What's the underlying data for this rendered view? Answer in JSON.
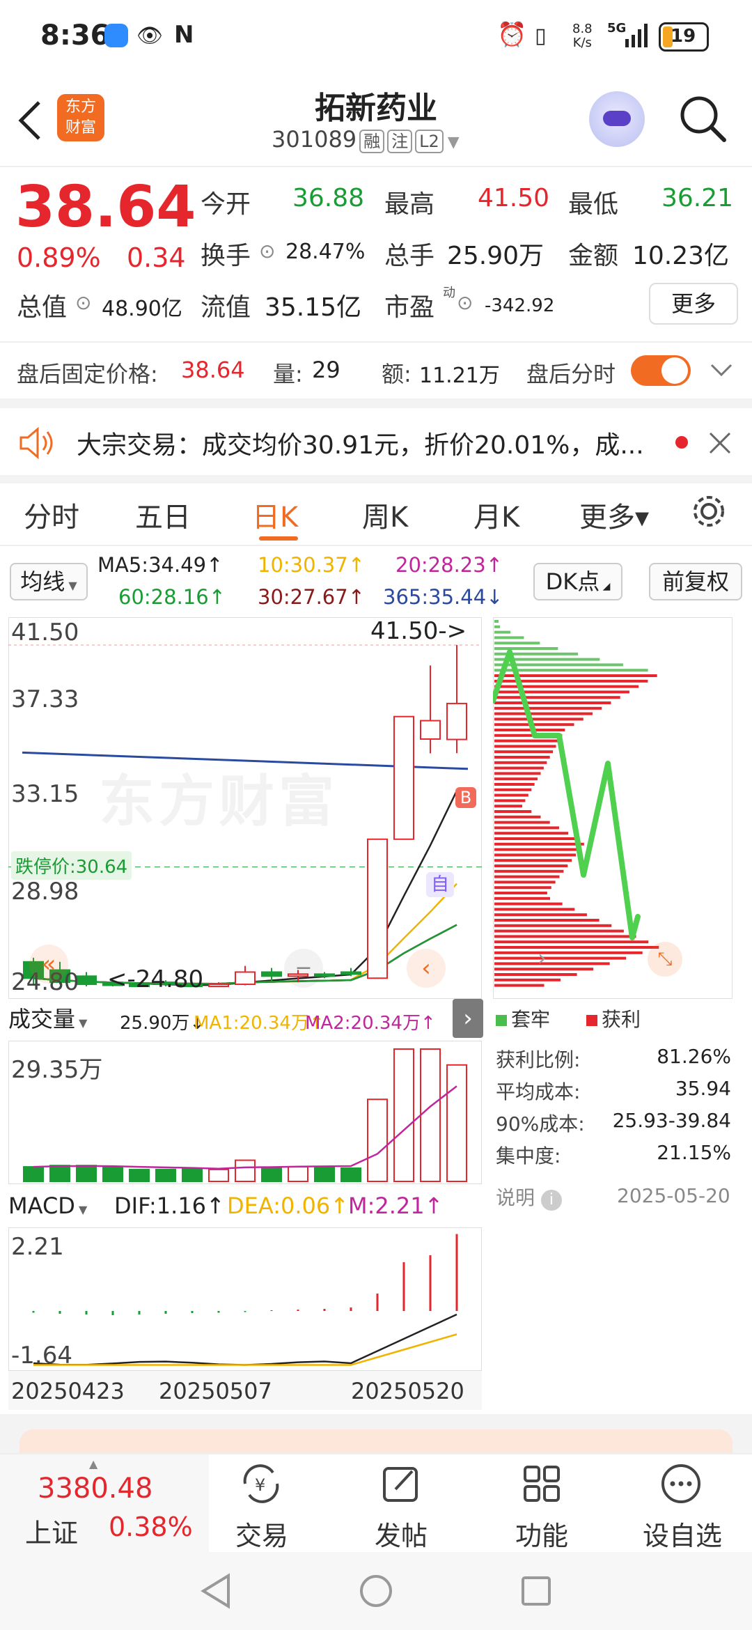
{
  "status_bar": {
    "time": "8:36",
    "net_speed_top": "8.8",
    "net_speed_bottom": "K/s",
    "network": "5G",
    "battery": "19"
  },
  "header": {
    "back_icon": "back-arrow-icon",
    "logo_line1": "东方",
    "logo_line2": "财富",
    "title": "拓新药业",
    "code": "301089",
    "tags": [
      "融",
      "注",
      "L2"
    ],
    "assistant_icon": "robot-avatar-icon",
    "search_icon": "search-icon"
  },
  "quote": {
    "price": "38.64",
    "change_pct": "0.89%",
    "change_amt": "0.34",
    "open_label": "今开",
    "open": "36.88",
    "high_label": "最高",
    "high": "41.50",
    "low_label": "最低",
    "low": "36.21",
    "turnover_label": "换手",
    "turnover": "28.47%",
    "volume_label": "总手",
    "volume": "25.90万",
    "amount_label": "金额",
    "amount": "10.23亿",
    "mktcap_label": "总值",
    "mktcap": "48.90亿",
    "float_label": "流值",
    "float": "35.15亿",
    "pe_label": "市盈",
    "pe_sup": "动",
    "pe": "-342.92",
    "more_label": "更多"
  },
  "after_hours": {
    "price_label": "盘后固定价格:",
    "price": "38.64",
    "vol_label": "量:",
    "vol": "29",
    "amt_label": "额:",
    "amt": "11.21万",
    "toggle_label": "盘后分时",
    "toggle_on": true
  },
  "news": {
    "text": "大宗交易：成交均价30.91元，折价20.01%，成...",
    "speaker_icon": "speaker-icon",
    "close_icon": "close-icon"
  },
  "tabs": [
    {
      "label": "分时",
      "active": false
    },
    {
      "label": "五日",
      "active": false
    },
    {
      "label": "日K",
      "active": true
    },
    {
      "label": "周K",
      "active": false
    },
    {
      "label": "月K",
      "active": false
    },
    {
      "label": "更多▾",
      "active": false
    }
  ],
  "ma_bar": {
    "selector": "均线",
    "ma5": "MA5:34.49↑",
    "ma10": "10:30.37↑",
    "ma20": "20:28.23↑",
    "ma60": "60:28.16↑",
    "ma30": "30:27.67↑",
    "ma365": "365:35.44↓",
    "dk_button": "DK点",
    "fq_button": "前复权"
  },
  "kline": {
    "y_ticks": [
      "41.50",
      "37.33",
      "33.15",
      "28.98",
      "24.80"
    ],
    "high_marker": "41.50->",
    "low_marker": "<-24.80",
    "limit_down_label": "跌停价:30.64",
    "watermark": "东方财富",
    "buy_badge": "B",
    "self_badge": "自",
    "candles": [
      {
        "o": 26.0,
        "c": 25.2,
        "h": 26.2,
        "l": 24.9
      },
      {
        "o": 25.6,
        "c": 25.0,
        "h": 26.0,
        "l": 24.9
      },
      {
        "o": 25.3,
        "c": 24.9,
        "h": 25.5,
        "l": 24.8
      },
      {
        "o": 25.0,
        "c": 24.85,
        "h": 25.1,
        "l": 24.8
      },
      {
        "o": 24.9,
        "c": 24.82,
        "h": 24.95,
        "l": 24.8
      },
      {
        "o": 25.0,
        "c": 24.9,
        "h": 25.1,
        "l": 24.8
      },
      {
        "o": 24.9,
        "c": 24.85,
        "h": 25.0,
        "l": 24.8
      },
      {
        "o": 24.85,
        "c": 24.9,
        "h": 25.0,
        "l": 24.8
      },
      {
        "o": 24.9,
        "c": 25.5,
        "h": 25.8,
        "l": 24.85
      },
      {
        "o": 25.5,
        "c": 25.3,
        "h": 25.7,
        "l": 25.0
      },
      {
        "o": 25.3,
        "c": 25.4,
        "h": 25.6,
        "l": 25.0
      },
      {
        "o": 25.4,
        "c": 25.3,
        "h": 25.5,
        "l": 25.2
      },
      {
        "o": 25.5,
        "c": 25.4,
        "h": 25.7,
        "l": 25.3
      },
      {
        "o": 25.2,
        "c": 32.0,
        "h": 32.0,
        "l": 25.2
      },
      {
        "o": 32.0,
        "c": 38.0,
        "h": 38.0,
        "l": 32.0
      },
      {
        "o": 36.9,
        "c": 37.8,
        "h": 40.5,
        "l": 36.2
      },
      {
        "o": 36.88,
        "c": 38.64,
        "h": 41.5,
        "l": 36.21
      }
    ]
  },
  "volume_panel": {
    "selector": "成交量",
    "vol": "25.90万↓",
    "ma1": "MA1:20.34万↑",
    "ma2": "MA2:20.34万↑",
    "top_label": "29.35万",
    "bars": [
      0.11,
      0.12,
      0.12,
      0.11,
      0.09,
      0.09,
      0.1,
      0.09,
      0.16,
      0.1,
      0.11,
      0.11,
      0.1,
      0.62,
      1.0,
      1.0,
      0.88
    ]
  },
  "macd_panel": {
    "selector": "MACD",
    "dif": "DIF:1.16↑",
    "dea": "DEA:0.06↑",
    "m": "M:2.21↑",
    "top_label": "2.21",
    "bottom_label": "-1.64",
    "hist": [
      -0.05,
      -0.08,
      -0.1,
      -0.12,
      -0.1,
      -0.08,
      -0.06,
      -0.05,
      -0.03,
      0.02,
      0.04,
      0.06,
      0.1,
      0.5,
      1.4,
      1.6,
      2.21
    ]
  },
  "x_labels": [
    "20250423",
    "20250507",
    "20250520"
  ],
  "chip": {
    "legend_trapped": "套牢",
    "legend_profit": "获利",
    "rows": [
      {
        "label": "获利比例:",
        "value": "81.26%"
      },
      {
        "label": "平均成本:",
        "value": "35.94"
      },
      {
        "label": "90%成本:",
        "value": "25.93-39.84"
      },
      {
        "label": "集中度:",
        "value": "21.15%"
      }
    ],
    "note_label": "说明",
    "date": "2025-05-20"
  },
  "bottom_nav": {
    "index_value": "3380.48",
    "index_name": "上证",
    "index_change": "0.38%",
    "items": [
      {
        "label": "交易",
        "icon": "yen-exchange-icon"
      },
      {
        "label": "发帖",
        "icon": "edit-icon"
      },
      {
        "label": "功能",
        "icon": "grid-icon"
      },
      {
        "label": "设自选",
        "icon": "more-dots-icon"
      }
    ]
  },
  "colors": {
    "red": "#e5262d",
    "green": "#1a9c35",
    "orange": "#f26b22"
  }
}
